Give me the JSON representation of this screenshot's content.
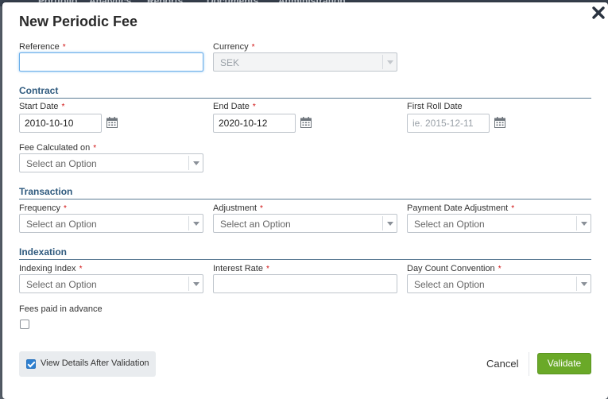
{
  "background_nav": [
    "Portfolio",
    "Analytics",
    "Reports",
    "Documents",
    "Administration"
  ],
  "modal": {
    "title": "New Periodic Fee",
    "close_icon": "close-icon"
  },
  "fields": {
    "reference": {
      "label": "Reference",
      "value": "",
      "required": true
    },
    "currency": {
      "label": "Currency",
      "value": "SEK",
      "required": true,
      "disabled": true
    }
  },
  "contract": {
    "heading": "Contract",
    "start_date": {
      "label": "Start Date",
      "value": "2010-10-10"
    },
    "end_date": {
      "label": "End Date",
      "value": "2020-10-12"
    },
    "first_roll_date": {
      "label": "First Roll Date",
      "placeholder": "ie. 2015-12-11"
    },
    "fee_calculated_on": {
      "label": "Fee Calculated on",
      "value": "Select an Option"
    }
  },
  "transaction": {
    "heading": "Transaction",
    "frequency": {
      "label": "Frequency",
      "value": "Select an Option"
    },
    "adjustment": {
      "label": "Adjustment",
      "value": "Select an Option"
    },
    "payment_date_adjustment": {
      "label": "Payment Date Adjustment",
      "value": "Select an Option"
    }
  },
  "indexation": {
    "heading": "Indexation",
    "indexing_index": {
      "label": "Indexing Index",
      "value": "Select an Option"
    },
    "interest_rate": {
      "label": "Interest Rate",
      "value": ""
    },
    "day_count_convention": {
      "label": "Day Count Convention",
      "value": "Select an Option"
    },
    "fees_paid_in_advance": {
      "label": "Fees paid in advance",
      "checked": false
    }
  },
  "footer": {
    "view_details": {
      "label": "View Details After Validation",
      "checked": true
    },
    "cancel": "Cancel",
    "validate": "Validate"
  },
  "required_marker": "*",
  "colors": {
    "accent_green": "#6aa928",
    "section_blue": "#2f5a7e",
    "required_red": "#d01010",
    "focus_blue": "#6aaee9"
  }
}
